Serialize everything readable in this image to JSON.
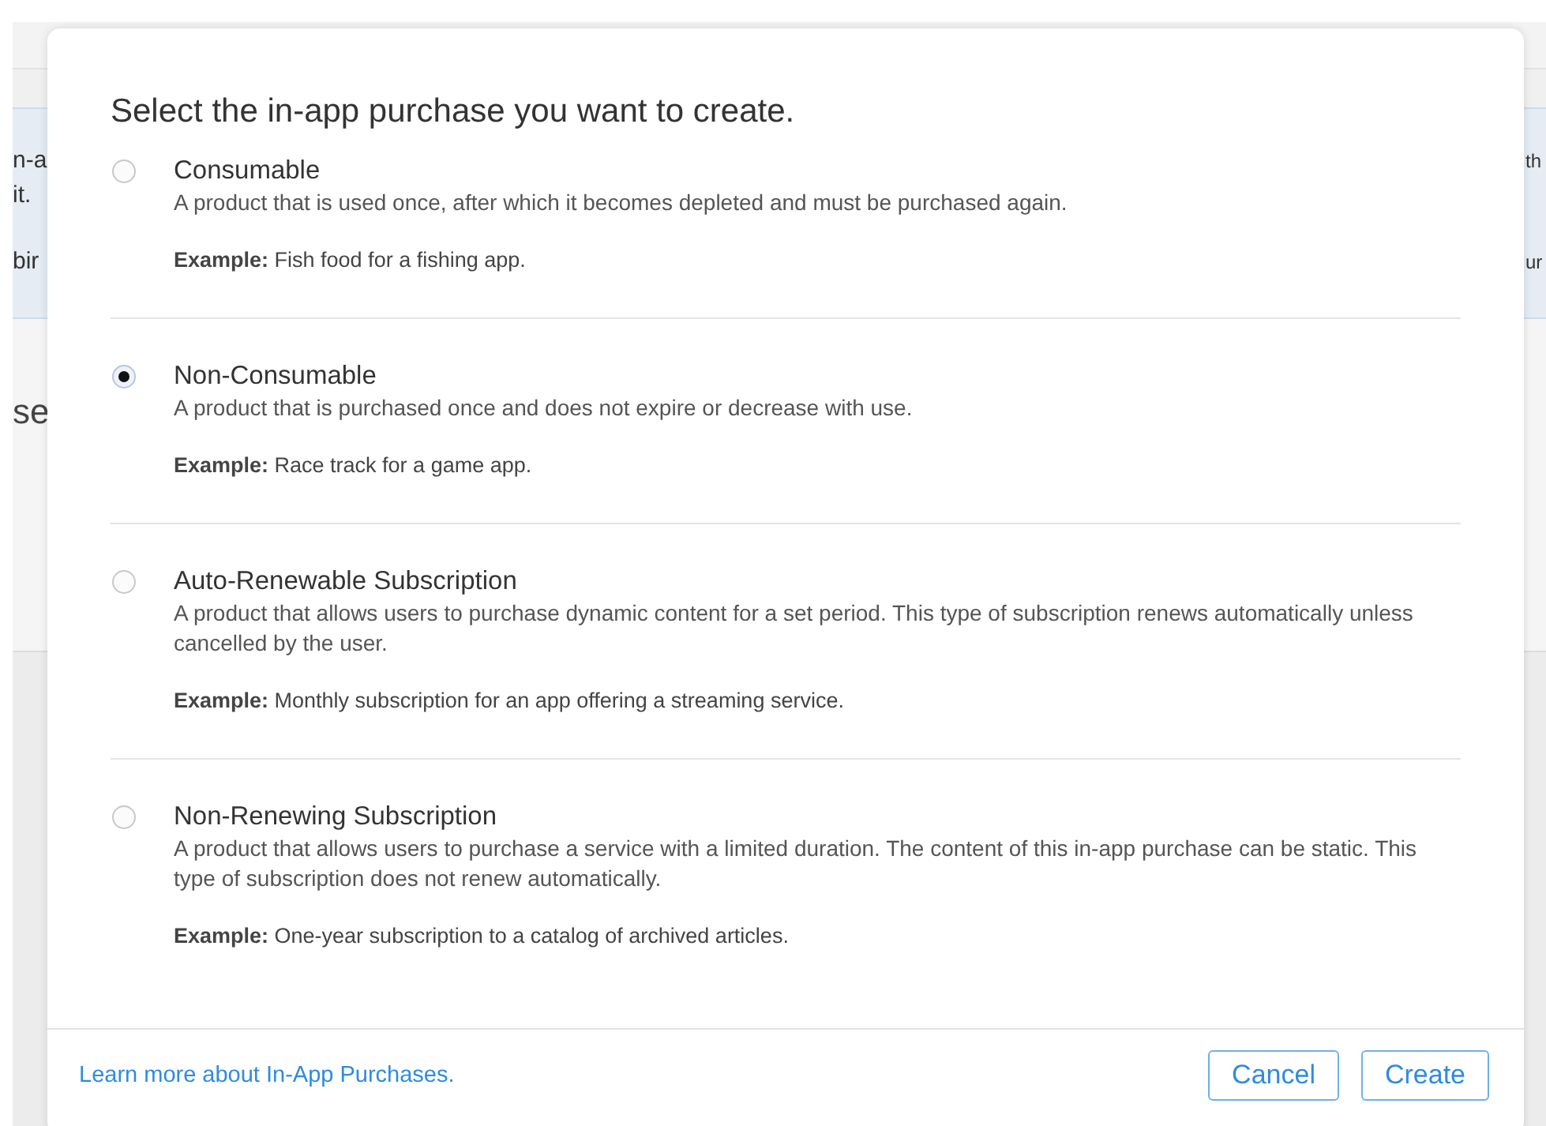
{
  "background": {
    "left_fragments": [
      "n-a",
      "it.",
      "bir",
      "se"
    ],
    "right_fragments": [
      "th",
      "ur"
    ]
  },
  "dialog": {
    "title": "Select the in-app purchase you want to create.",
    "options": [
      {
        "name": "Consumable",
        "description": "A product that is used once, after which it becomes depleted and must be purchased again.",
        "example": "**Example:** Fish food for a fishing app.",
        "selected": false
      },
      {
        "name": "Non-Consumable",
        "description": "A product that is purchased once and does not expire or decrease with use.",
        "example": "**Example:** Race track for a game app.",
        "selected": true
      },
      {
        "name": "Auto-Renewable Subscription",
        "description": "A product that allows users to purchase dynamic content for a set period. This type of subscription renews automatically unless cancelled by the user.",
        "example": "**Example:** Monthly subscription for an app offering a streaming service.",
        "selected": false
      },
      {
        "name": "Non-Renewing Subscription",
        "description": "A product that allows users to purchase a service with a limited duration. The content of this in-app purchase can be static. This type of subscription does not renew automatically.",
        "example": "**Example:** One-year subscription to a catalog of archived articles.",
        "selected": false
      }
    ],
    "footer_link": "Learn more about In-App Purchases.",
    "buttons": [
      "Cancel",
      "Create"
    ]
  }
}
